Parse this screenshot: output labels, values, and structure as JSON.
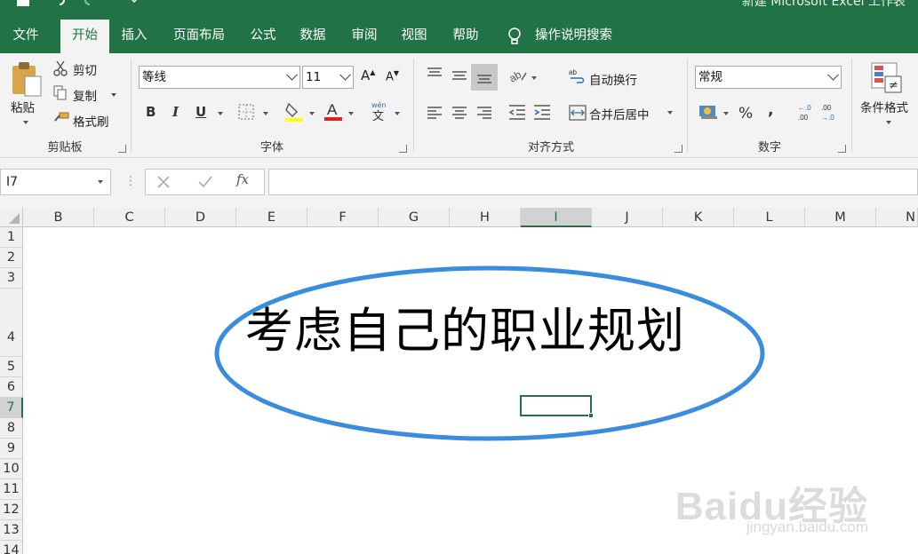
{
  "window": {
    "title": "新建 Microsoft Excel 工作表"
  },
  "tabs": [
    {
      "label": "文件"
    },
    {
      "label": "开始"
    },
    {
      "label": "插入"
    },
    {
      "label": "页面布局"
    },
    {
      "label": "公式"
    },
    {
      "label": "数据"
    },
    {
      "label": "审阅"
    },
    {
      "label": "视图"
    },
    {
      "label": "帮助"
    }
  ],
  "active_tab": "开始",
  "tell_me": "操作说明搜索",
  "ribbon": {
    "clipboard": {
      "label": "剪贴板",
      "paste": "粘贴",
      "cut": "剪切",
      "copy": "复制",
      "painter": "格式刷"
    },
    "font": {
      "label": "字体",
      "font_name": "等线",
      "font_size": "11",
      "bold": "B",
      "italic": "I",
      "underline": "U"
    },
    "alignment": {
      "label": "对齐方式",
      "wrap": "自动换行",
      "merge": "合并后居中"
    },
    "number": {
      "label": "数字",
      "format": "常规"
    },
    "styles": {
      "cond_format": "条件格式"
    }
  },
  "formula_bar": {
    "name_box": "I7",
    "formula": ""
  },
  "sheet": {
    "columns": [
      "B",
      "C",
      "D",
      "E",
      "F",
      "G",
      "H",
      "I",
      "J",
      "K",
      "L",
      "M",
      "N"
    ],
    "selected_column": "I",
    "rows": [
      "1",
      "2",
      "3",
      "4",
      "5",
      "6",
      "7",
      "8",
      "9",
      "10",
      "11",
      "12",
      "13",
      "14"
    ],
    "selected_row": "7",
    "cell_text": "考虑自己的职业规划",
    "shape_outline_color": "#3a8ddd"
  },
  "colors": {
    "excel_green": "#217346"
  },
  "watermark": {
    "main": "Baidu经验",
    "sub": "jingyan.baidu.com"
  }
}
